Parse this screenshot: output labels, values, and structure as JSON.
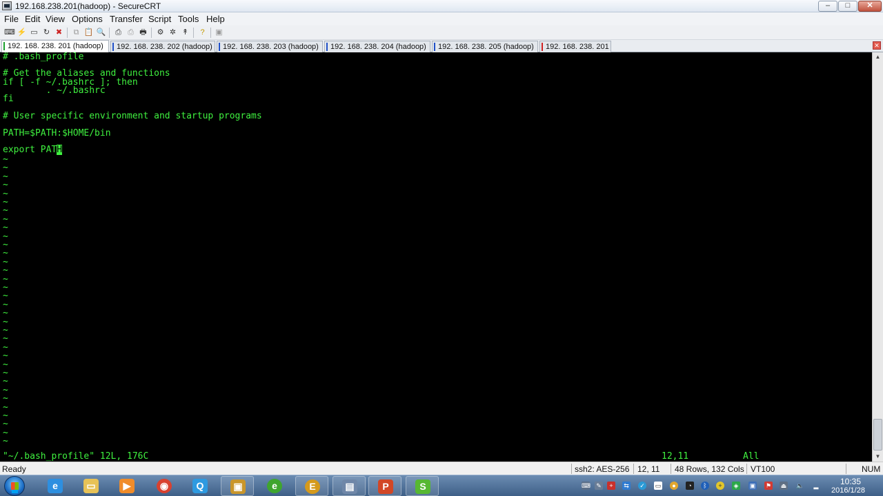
{
  "window": {
    "title": "192.168.238.201(hadoop) - SecureCRT",
    "controls": {
      "minimize": "–",
      "maximize": "□",
      "close": "✕"
    }
  },
  "menu": [
    "File",
    "Edit",
    "View",
    "Options",
    "Transfer",
    "Script",
    "Tools",
    "Help"
  ],
  "toolbar": {
    "icons": [
      "connect-icon",
      "quick-connect-icon",
      "connect-in-tab-icon",
      "reconnect-icon",
      "disconnect-icon",
      "copy-icon",
      "paste-icon",
      "find-icon",
      "print-setup-icon",
      "print-selection-icon",
      "print-icon",
      "session-options-icon",
      "global-options-icon",
      "keymap-icon",
      "help-icon",
      "options-icon"
    ]
  },
  "tabs": [
    {
      "label": "192. 168. 238. 201 (hadoop)",
      "active": true,
      "status": "ok"
    },
    {
      "label": "192. 168. 238. 202 (hadoop)",
      "active": false,
      "status": "connected"
    },
    {
      "label": "192. 168. 238. 203 (hadoop)",
      "active": false,
      "status": "connected"
    },
    {
      "label": "192. 168. 238. 204 (hadoop)",
      "active": false,
      "status": "connected"
    },
    {
      "label": "192. 168. 238. 205 (hadoop)",
      "active": false,
      "status": "connected"
    },
    {
      "label": "192. 168. 238. 201",
      "active": false,
      "status": "error"
    }
  ],
  "terminal": {
    "color": "#3ff03f",
    "lines": [
      "# .bash_profile",
      "",
      "# Get the aliases and functions",
      "if [ -f ~/.bashrc ]; then",
      "        . ~/.bashrc",
      "fi",
      "",
      "# User specific environment and startup programs",
      "",
      "PATH=$PATH:$HOME/bin",
      "",
      "export PAT"
    ],
    "cursor_char": "H",
    "tilde": "~",
    "tilde_count": 34,
    "status_line": "\"~/.bash_profile\" 12L, 176C",
    "position": "12,11",
    "scroll": "All"
  },
  "statusbar": {
    "ready": "Ready",
    "cipher": "ssh2: AES-256",
    "cursor": "12,  11",
    "size": "48 Rows, 132 Cols",
    "emulation": "VT100",
    "num": "NUM"
  },
  "taskbar": {
    "apps": [
      {
        "name": "internet-explorer",
        "glyph": "e",
        "color": "#2d8fe0"
      },
      {
        "name": "file-explorer",
        "glyph": "▭",
        "color": "#e7c257"
      },
      {
        "name": "media-player",
        "glyph": "▶",
        "color": "#f08c2a"
      },
      {
        "name": "chrome",
        "glyph": "◉",
        "color": "#d9412f"
      },
      {
        "name": "qq-browser",
        "glyph": "Q",
        "color": "#2e9ae0"
      },
      {
        "name": "securecrt",
        "glyph": "🔒",
        "color": "#c9962b"
      },
      {
        "name": "ie-green",
        "glyph": "e",
        "color": "#3fa52e"
      },
      {
        "name": "editor",
        "glyph": "E",
        "color": "#d59a1c"
      },
      {
        "name": "remote-desktop",
        "glyph": "▤",
        "color": "#6f87a8"
      },
      {
        "name": "powerpoint",
        "glyph": "P",
        "color": "#d24726"
      },
      {
        "name": "xshell",
        "glyph": "S",
        "color": "#57b832"
      }
    ],
    "clock_time": "10:35",
    "clock_date": "2016/1/28"
  }
}
